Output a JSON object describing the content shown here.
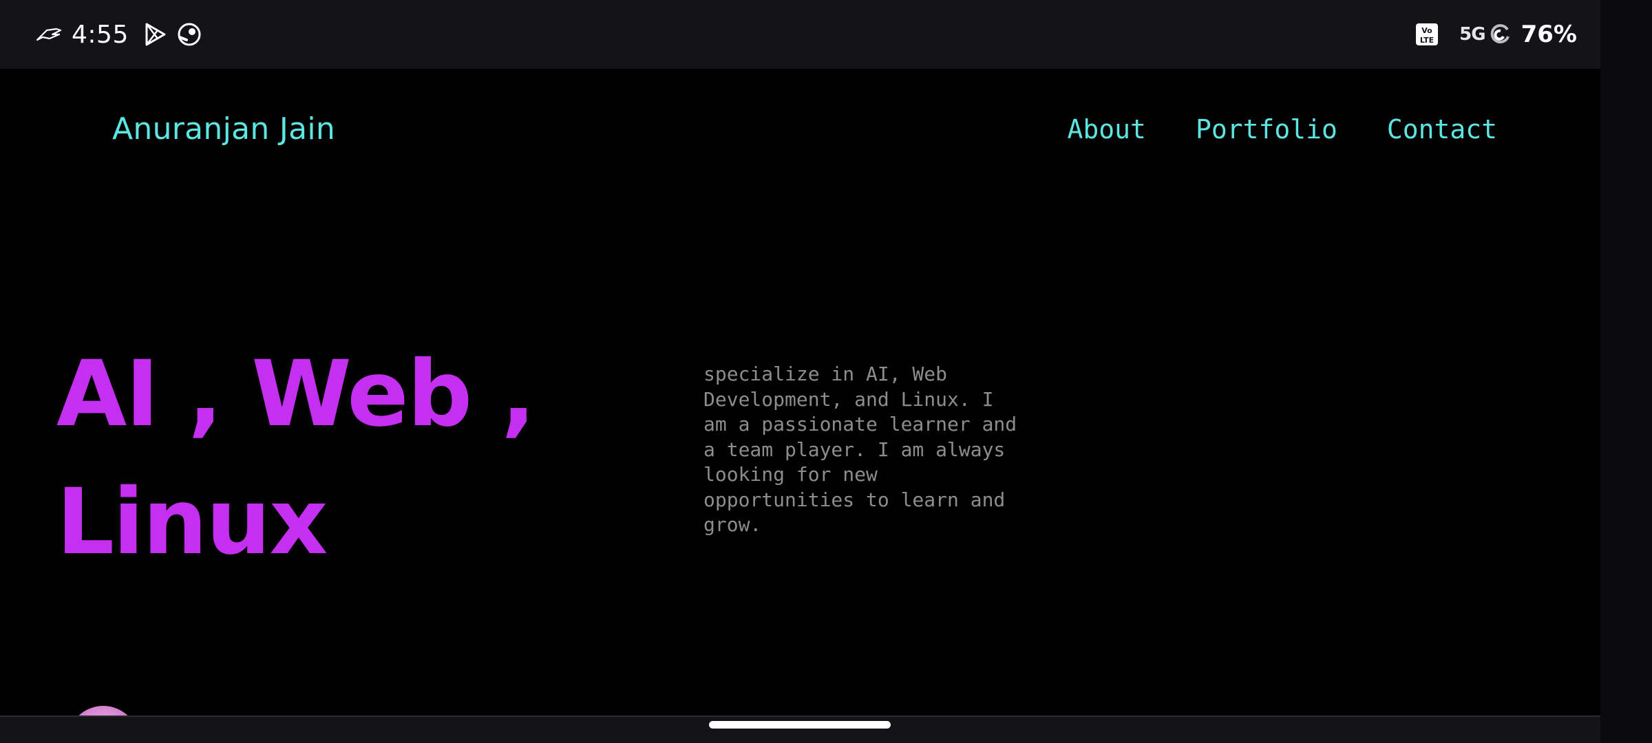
{
  "status_bar": {
    "time": "4:55",
    "battery": "76%",
    "network": "5G",
    "icons": [
      "rog-icon",
      "play-store-icon",
      "steam-icon",
      "volte-icon",
      "signal-sync-icon"
    ]
  },
  "site": {
    "brand": "Anuranjan Jain",
    "nav": [
      {
        "label": "About"
      },
      {
        "label": "Portfolio"
      },
      {
        "label": "Contact"
      }
    ]
  },
  "hero": {
    "title_line1": "AI , Web ,",
    "title_line2": "Linux",
    "description": "specialize in AI, Web Development, and Linux. I am a passionate learner and a team player. I am always looking for new opportunities to learn and grow."
  },
  "colors": {
    "accent_cyan": "#5de6e1",
    "accent_purple": "#c42ff0",
    "background": "#000000",
    "muted_text": "#8d8d8d"
  }
}
